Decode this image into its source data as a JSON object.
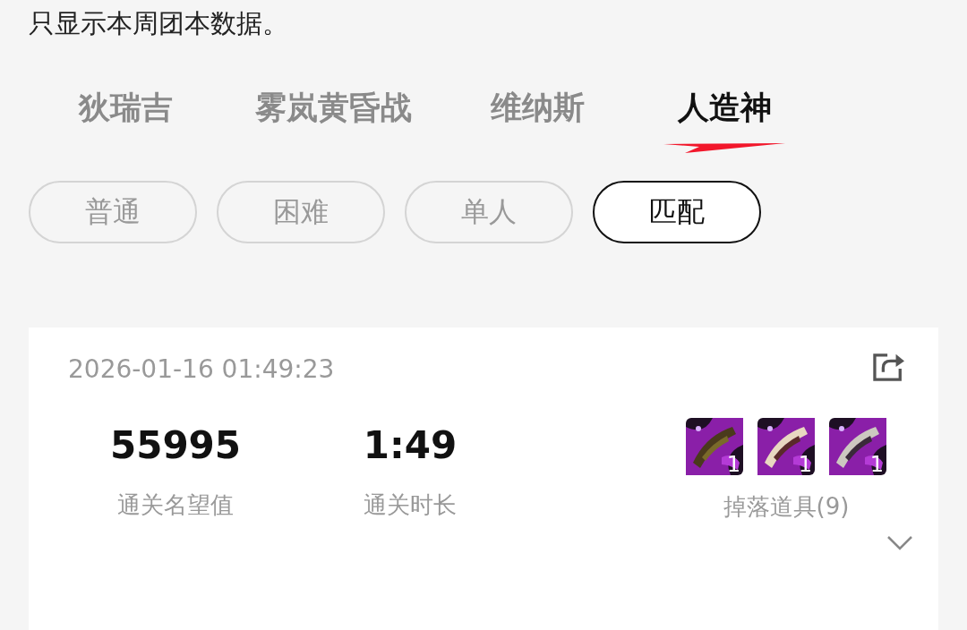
{
  "notice": "只显示本周团本数据。",
  "tabs": [
    {
      "label": "狄瑞吉",
      "selected": false
    },
    {
      "label": "雾岚黄昏战",
      "selected": false
    },
    {
      "label": "维纳斯",
      "selected": false
    },
    {
      "label": "人造神",
      "selected": true
    }
  ],
  "modes": [
    {
      "label": "普通",
      "selected": false
    },
    {
      "label": "困难",
      "selected": false
    },
    {
      "label": "单人",
      "selected": false
    },
    {
      "label": "匹配",
      "selected": true
    }
  ],
  "record": {
    "time": "2026-01-16 01:49:23",
    "stats": [
      {
        "value": "55995",
        "label": "通关名望值"
      },
      {
        "value": "1:49",
        "label": "通关时长"
      }
    ],
    "drops": {
      "items": [
        {
          "kind": "picture",
          "count": "1"
        },
        {
          "kind": "picture",
          "count": "1"
        },
        {
          "kind": "picture",
          "count": "1"
        }
      ],
      "label": "掉落道具(9)"
    }
  }
}
